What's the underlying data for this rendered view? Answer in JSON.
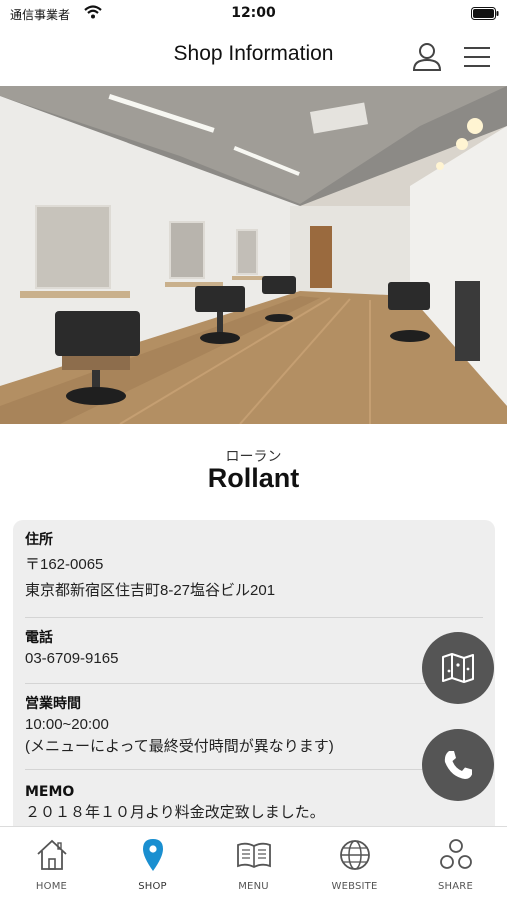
{
  "status_bar": {
    "carrier": "通信事業者",
    "time": "12:00"
  },
  "header": {
    "title": "Shop Information"
  },
  "shop": {
    "name_kana": "ローラン",
    "name": "Rollant"
  },
  "info": {
    "address": {
      "label": "住所",
      "postal": "〒162-0065",
      "street": "東京都新宿区住吉町8-27塩谷ビル201"
    },
    "phone": {
      "label": "電話",
      "value": "03-6709-9165"
    },
    "hours": {
      "label": "営業時間",
      "value": "10:00~20:00",
      "note": "(メニューによって最終受付時間が異なります)"
    },
    "memo": {
      "label": "MEMO",
      "value": "２０１８年１０月より料金改定致しました。"
    }
  },
  "tabs": [
    {
      "label": "HOME",
      "icon": "home-icon"
    },
    {
      "label": "SHOP",
      "icon": "map-pin-icon",
      "active": true
    },
    {
      "label": "MENU",
      "icon": "book-icon"
    },
    {
      "label": "WEBSITE",
      "icon": "globe-icon"
    },
    {
      "label": "SHARE",
      "icon": "share-icon"
    }
  ],
  "colors": {
    "accent": "#1a8fd0",
    "fab": "#555555",
    "card": "#eeeeee"
  }
}
